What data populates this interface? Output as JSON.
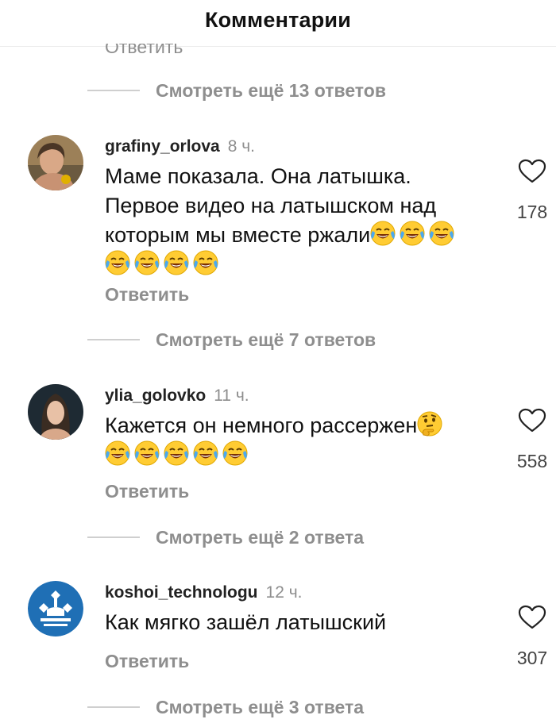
{
  "header": {
    "title": "Комментарии"
  },
  "cut_reply": "Ответить",
  "view_replies": [
    "Смотреть ещё 13 ответов",
    "Смотреть ещё 7 ответов",
    "Смотреть ещё 2 ответа",
    "Смотреть ещё 3 ответа"
  ],
  "comments": [
    {
      "username": "grafiny_orlova",
      "time": "8 ч.",
      "text_lines": [
        "Маме показала. Она латышка.",
        "Первое видео на латышском над",
        "которым мы вместе ржали"
      ],
      "emojis": [
        "face-with-tears-of-joy",
        "face-with-tears-of-joy",
        "face-with-tears-of-joy",
        "face-with-tears-of-joy",
        "face-with-tears-of-joy",
        "face-with-tears-of-joy",
        "face-with-tears-of-joy"
      ],
      "reply": "Ответить",
      "likes": "178"
    },
    {
      "username": "ylia_golovko",
      "time": "11 ч.",
      "text_lines": [
        "Кажется он немного рассержен"
      ],
      "emojis": [
        "thinking-face",
        "face-with-tears-of-joy",
        "face-with-tears-of-joy",
        "face-with-tears-of-joy",
        "face-with-tears-of-joy",
        "face-with-tears-of-joy"
      ],
      "reply": "Ответить",
      "likes": "558"
    },
    {
      "username": "koshoi_technologu",
      "time": "12 ч.",
      "text_lines": [
        "Как мягко зашёл латышский"
      ],
      "reply": "Ответить",
      "likes": "307"
    }
  ],
  "colors": {
    "secondary_text": "#8e8e8e",
    "divider": "#cfcfcf",
    "logo_blue": "#1f6fb5"
  }
}
